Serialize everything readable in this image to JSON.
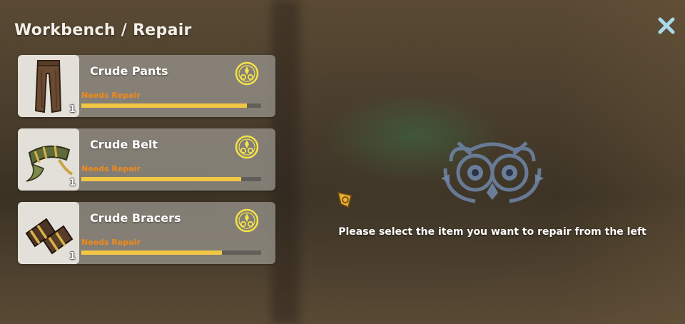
{
  "title": "Workbench / Repair",
  "close_icon": "close-icon",
  "items": [
    {
      "name": "Crude Pants",
      "status": "Needs Repair",
      "quantity": "1",
      "durability_pct": 92,
      "icon": "pants-icon"
    },
    {
      "name": "Crude Belt",
      "status": "Needs Repair",
      "quantity": "1",
      "durability_pct": 89,
      "icon": "belt-icon"
    },
    {
      "name": "Crude Bracers",
      "status": "Needs Repair",
      "quantity": "1",
      "durability_pct": 78,
      "icon": "bracers-icon"
    }
  ],
  "hint": "Please select the item you want to repair from the left",
  "colors": {
    "status": "#f08a1c",
    "durability": "#f2c744",
    "repair_icon": "#f3e34a",
    "close": "#a9d9ea"
  }
}
